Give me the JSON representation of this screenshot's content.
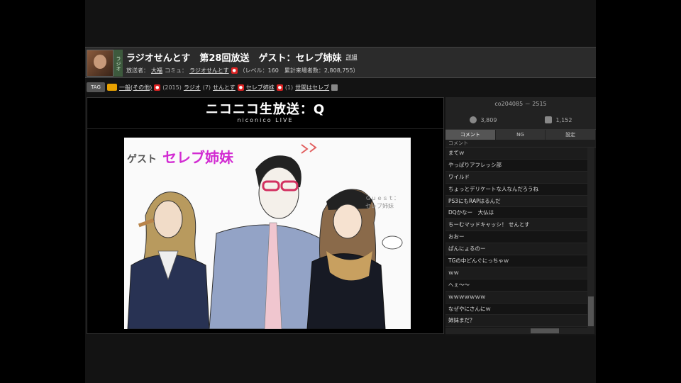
{
  "header": {
    "side_tag": "ラジオ",
    "title": "ラジオせんとす　第28回放送　ゲスト：セレブ姉妹",
    "detail_link": "詳細",
    "meta_1": "放送者：",
    "owner_link": "大福",
    "community_prefix": "コミュ：",
    "community_link": "ラジオせんとす",
    "community_level": "（レベル：160　累計来場者数：2,808,755）"
  },
  "tags": {
    "icon_label": "TAG",
    "items": [
      {
        "name": "一般(その他)",
        "count": "(2015)"
      },
      {
        "name": "ラジオ",
        "count": "(7)"
      },
      {
        "name": "せんとす",
        "count": ""
      },
      {
        "name": "セレブ姉妹",
        "count": "(1)"
      },
      {
        "name": "世間はセレブ",
        "count": ""
      }
    ]
  },
  "player": {
    "logo_main": "ニコニコ生放送：Q",
    "logo_sub": "niconico LIVE",
    "art_guest": "ゲスト",
    "art_name": "セレブ姉妹",
    "art_note": "Ｇｕｅｓｔ：セレブ姉妹"
  },
  "chat": {
    "lv_text": "co204085 － 2515",
    "viewers": "3,809",
    "comments": "1,152",
    "tabs": [
      "コメント",
      "NG",
      "設定"
    ],
    "col_header": "コメント",
    "rows": [
      "まてｗ",
      "やっぱりアフレッシ部",
      "ワイルド",
      "ちょっとデリケートな人なんだろうね",
      "PS3にもRAPはるんだ",
      "DQかなー　大仏は",
      "ちーむマッドキャッシ！ せんとす",
      "おおー",
      "ぱんにょるのー",
      "TGの中どんぐにっちゃｗ",
      "ｗｗ",
      "へぇ～～",
      "ｗｗｗｗｗｗｗ",
      "なぜやにさんにｗ",
      "姉妹まだ？"
    ]
  },
  "colors": {
    "accent_pink": "#d22bd2",
    "lock_red": "#dd2222",
    "badge_orange": "#e8a100"
  }
}
